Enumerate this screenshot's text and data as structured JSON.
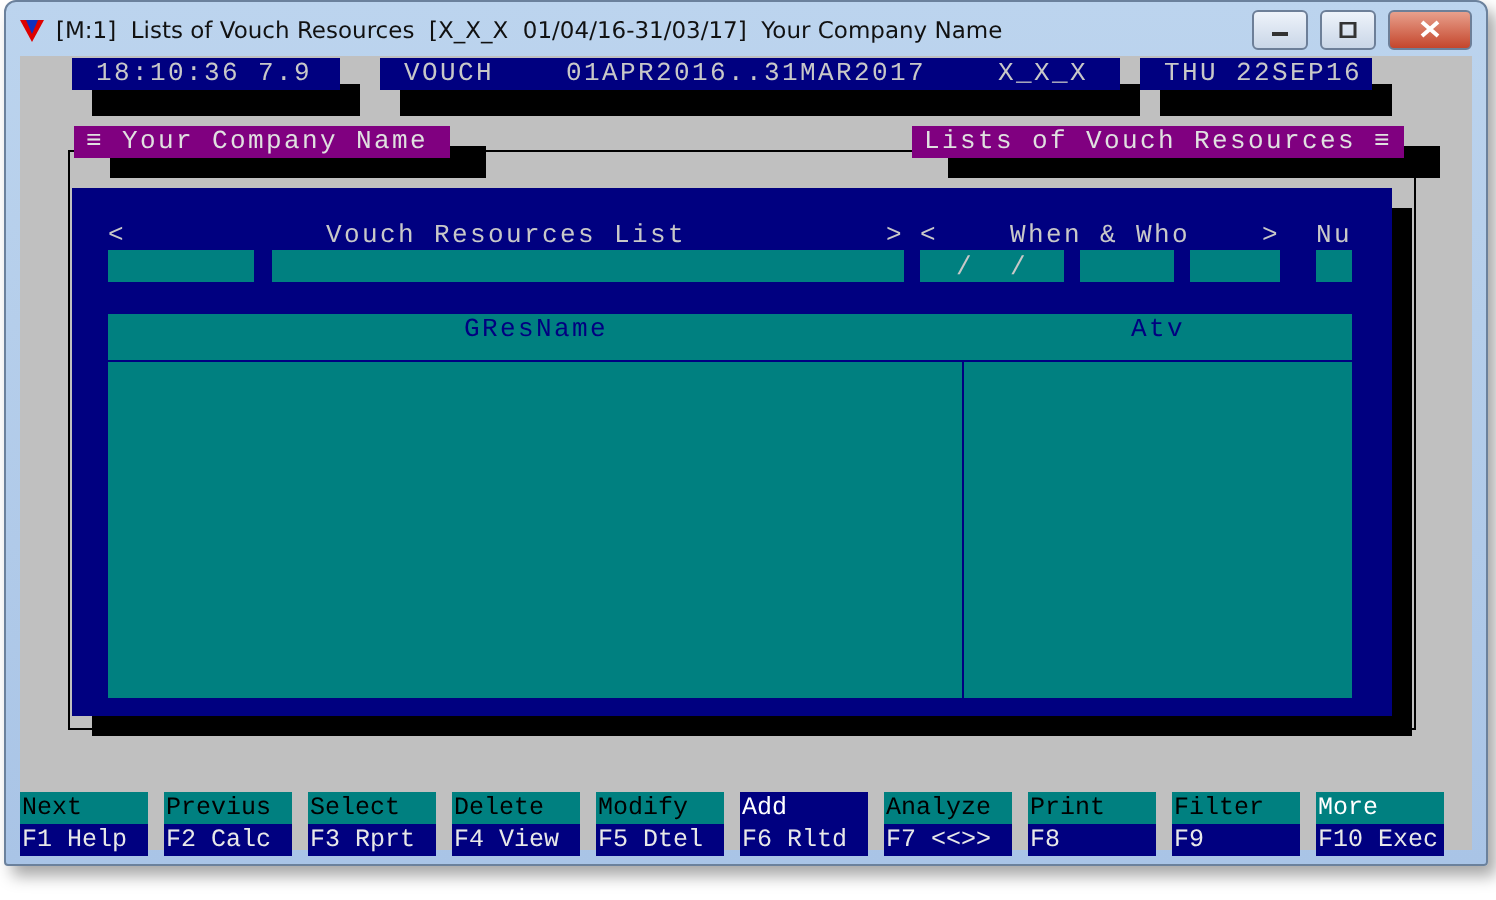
{
  "window": {
    "title": "[M:1]  Lists of Vouch Resources  [X_X_X  01/04/16-31/03/17]  Your Company Name"
  },
  "status_boxes": [
    "18:10:36 7.9",
    "VOUCH    01APR2016..31MAR2017    X_X_X",
    "THU 22SEP16"
  ],
  "frame": {
    "left_title": "≡ Your Company Name",
    "right_title": "Lists of Vouch Resources ≡"
  },
  "form": {
    "groups": [
      {
        "open": "<",
        "title": "Vouch Resources List",
        "close": ">"
      },
      {
        "open": "<",
        "title": "When & Who",
        "close": ">"
      }
    ],
    "extra_label": "Nu",
    "fields": [
      {
        "kind": "text"
      },
      {
        "kind": "text"
      },
      {
        "kind": "date",
        "value": "/  /"
      },
      {
        "kind": "text"
      },
      {
        "kind": "text"
      },
      {
        "kind": "text"
      }
    ]
  },
  "table": {
    "columns": [
      "GResName",
      "Atv"
    ]
  },
  "function_keys": [
    {
      "action": "Next",
      "key": "F1 Help",
      "selected": false,
      "hot": false
    },
    {
      "action": "Previus",
      "key": "F2 Calc",
      "selected": false,
      "hot": false
    },
    {
      "action": "Select",
      "key": "F3 Rprt",
      "selected": false,
      "hot": false
    },
    {
      "action": "Delete",
      "key": "F4 View",
      "selected": false,
      "hot": false
    },
    {
      "action": "Modify",
      "key": "F5 Dtel",
      "selected": false,
      "hot": false
    },
    {
      "action": "Add",
      "key": "F6 Rltd",
      "selected": true,
      "hot": false
    },
    {
      "action": "Analyze",
      "key": "F7 <<>>",
      "selected": false,
      "hot": false
    },
    {
      "action": "Print",
      "key": "F8",
      "selected": false,
      "hot": false
    },
    {
      "action": "Filter",
      "key": "F9",
      "selected": false,
      "hot": false
    },
    {
      "action": "More",
      "key": "F10 Exec",
      "selected": false,
      "hot": true
    }
  ]
}
